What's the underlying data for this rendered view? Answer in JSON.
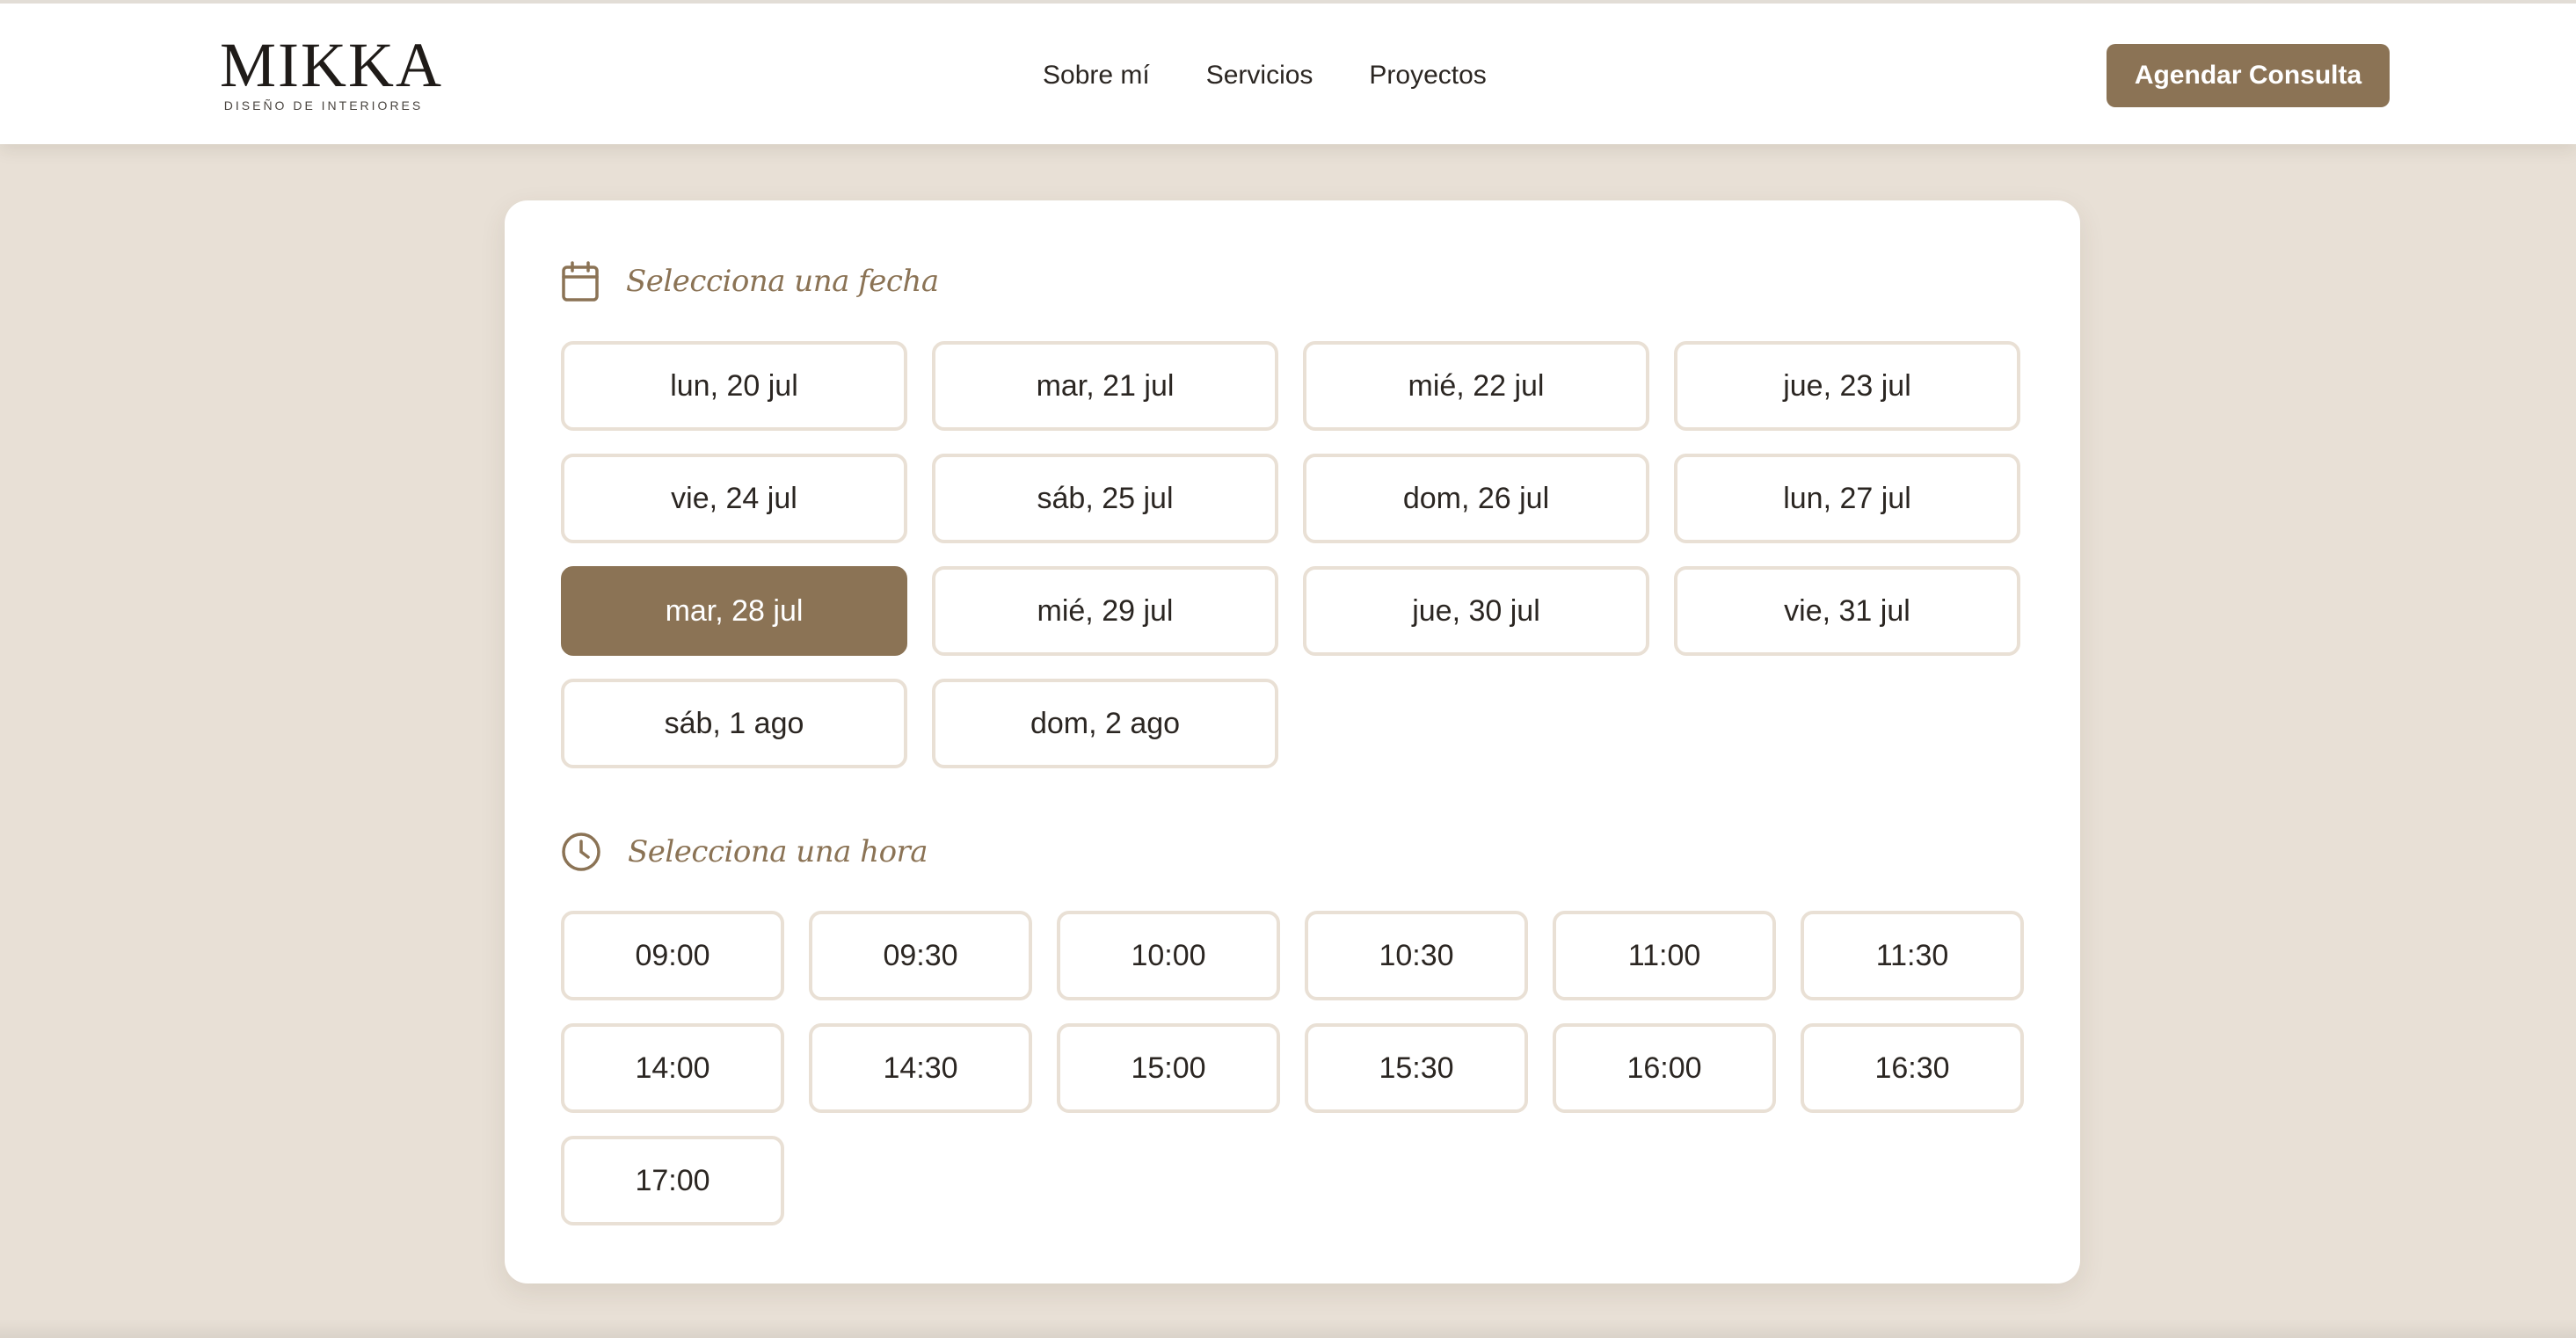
{
  "brand": {
    "name": "MIKKA",
    "tagline": "DISEÑO DE INTERIORES"
  },
  "nav": {
    "items": [
      {
        "label": "Sobre mí"
      },
      {
        "label": "Servicios"
      },
      {
        "label": "Proyectos"
      }
    ],
    "cta_label": "Agendar Consulta"
  },
  "booking": {
    "date_section": {
      "icon": "calendar-icon",
      "title": "Selecciona una fecha",
      "dates": [
        {
          "label": "lun, 20 jul",
          "selected": false
        },
        {
          "label": "mar, 21 jul",
          "selected": false
        },
        {
          "label": "mié, 22 jul",
          "selected": false
        },
        {
          "label": "jue, 23 jul",
          "selected": false
        },
        {
          "label": "vie, 24 jul",
          "selected": false
        },
        {
          "label": "sáb, 25 jul",
          "selected": false
        },
        {
          "label": "dom, 26 jul",
          "selected": false
        },
        {
          "label": "lun, 27 jul",
          "selected": false
        },
        {
          "label": "mar, 28 jul",
          "selected": true
        },
        {
          "label": "mié, 29 jul",
          "selected": false
        },
        {
          "label": "jue, 30 jul",
          "selected": false
        },
        {
          "label": "vie, 31 jul",
          "selected": false
        },
        {
          "label": "sáb, 1 ago",
          "selected": false
        },
        {
          "label": "dom, 2 ago",
          "selected": false
        }
      ]
    },
    "time_section": {
      "icon": "clock-icon",
      "title": "Selecciona una hora",
      "times": [
        {
          "label": "09:00"
        },
        {
          "label": "09:30"
        },
        {
          "label": "10:00"
        },
        {
          "label": "10:30"
        },
        {
          "label": "11:00"
        },
        {
          "label": "11:30"
        },
        {
          "label": "14:00"
        },
        {
          "label": "14:30"
        },
        {
          "label": "15:00"
        },
        {
          "label": "15:30"
        },
        {
          "label": "16:00"
        },
        {
          "label": "16:30"
        },
        {
          "label": "17:00"
        }
      ]
    }
  },
  "colors": {
    "accent": "#8b7355",
    "page_background": "#e8e0d6",
    "slot_border": "#e9e0d5",
    "text": "#2b2622"
  }
}
